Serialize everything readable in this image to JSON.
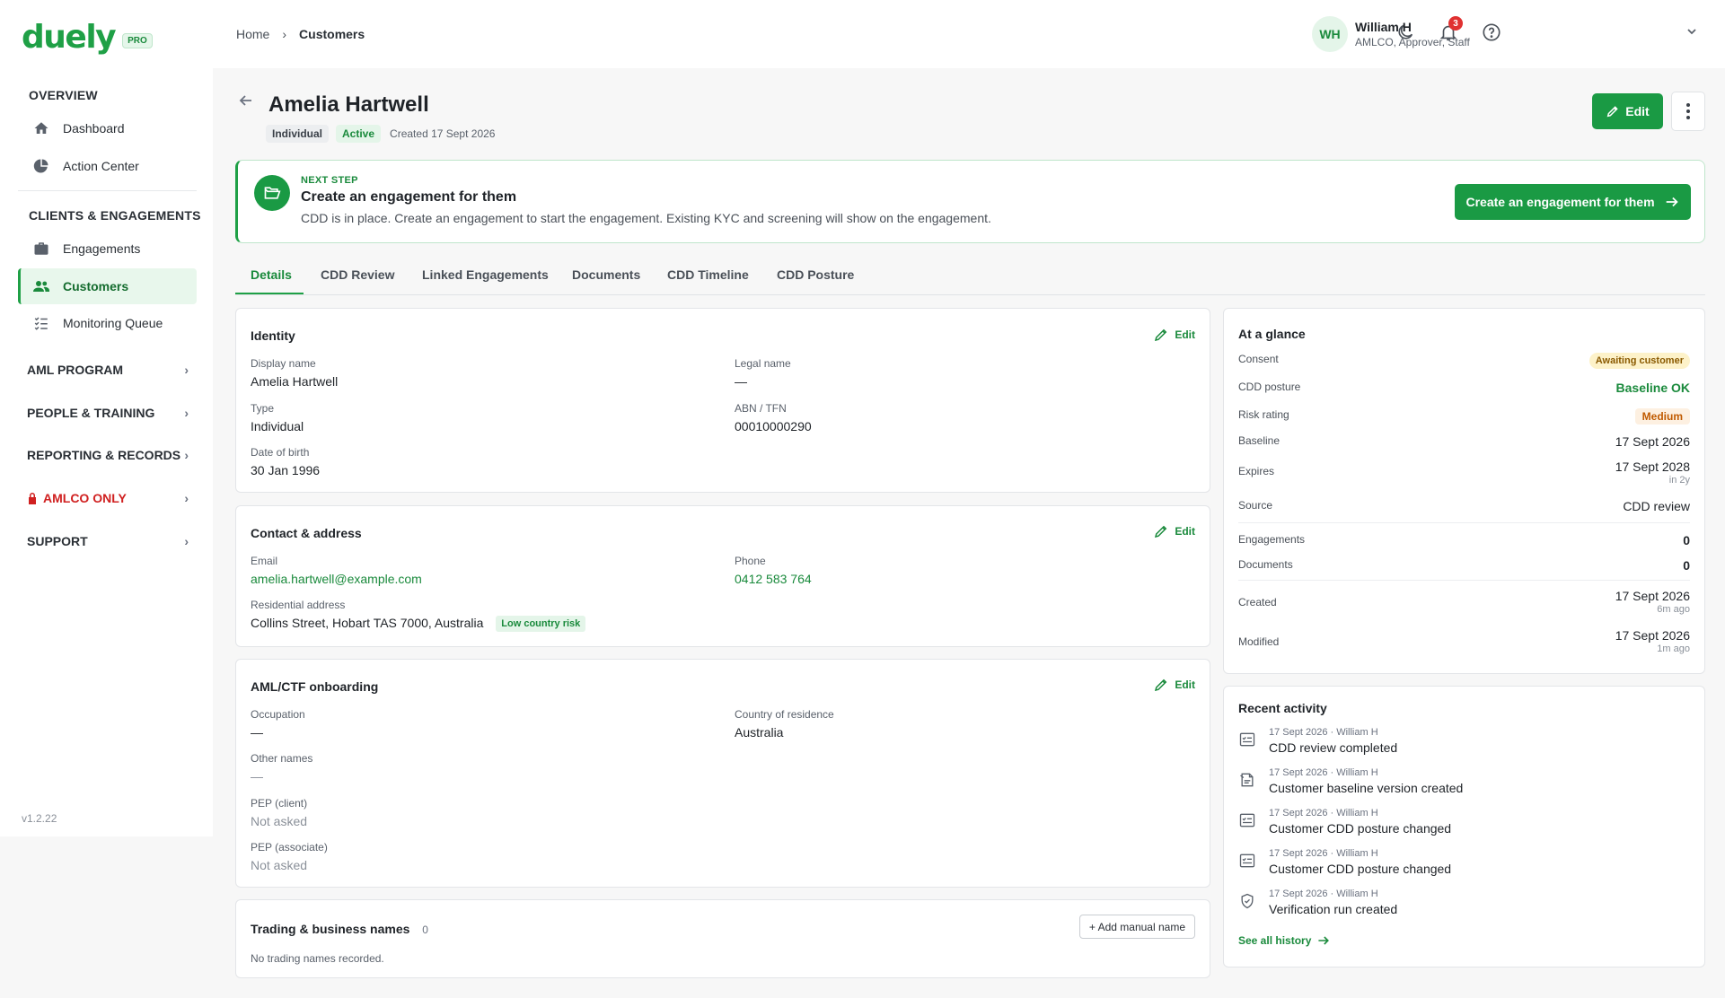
{
  "brand": {
    "name": "duely",
    "tier": "PRO"
  },
  "sidebar": {
    "overview_heading": "OVERVIEW",
    "overview_items": [
      {
        "label": "Dashboard",
        "icon": "home-icon"
      },
      {
        "label": "Action Center",
        "icon": "pie-chart-icon"
      }
    ],
    "clients_heading": "CLIENTS & ENGAGEMENTS",
    "clients_items": [
      {
        "label": "Engagements",
        "icon": "briefcase-icon"
      },
      {
        "label": "Customers",
        "icon": "users-icon",
        "active": true
      },
      {
        "label": "Monitoring Queue",
        "icon": "list-check-icon"
      }
    ],
    "groups": [
      {
        "label": "AML PROGRAM"
      },
      {
        "label": "PEOPLE & TRAINING"
      },
      {
        "label": "REPORTING & RECORDS"
      },
      {
        "label": "AMLCO ONLY",
        "icon": "lock-icon",
        "color": "#d02020"
      },
      {
        "label": "SUPPORT"
      }
    ],
    "version": "v1.2.22"
  },
  "topbar": {
    "breadcrumb": [
      "Home",
      "Customers"
    ],
    "notifications_count": "3",
    "user": {
      "initials": "WH",
      "name": "William H",
      "role": "AMLCO, Approver, Staff"
    }
  },
  "header": {
    "title": "Amelia Hartwell",
    "type_tag": "Individual",
    "status_tag": "Active",
    "created": "Created 17 Sept 2026",
    "edit_label": "Edit"
  },
  "banner": {
    "kicker": "NEXT STEP",
    "title": "Create an engagement for them",
    "description": "CDD is in place. Create an engagement to start the engagement. Existing KYC and screening will show on the engagement.",
    "button_label": "Create an engagement for them"
  },
  "tabs": [
    "Details",
    "CDD Review",
    "Linked Engagements",
    "Documents",
    "CDD Timeline",
    "CDD Posture"
  ],
  "identity": {
    "title": "Identity",
    "edit_label": "Edit",
    "display_name_label": "Display name",
    "display_name": "Amelia Hartwell",
    "legal_name_label": "Legal name",
    "legal_name": "—",
    "type_label": "Type",
    "type": "Individual",
    "abn_label": "ABN / TFN",
    "abn": "00010000290",
    "dob_label": "Date of birth",
    "dob": "30 Jan 1996"
  },
  "contact": {
    "title": "Contact & address",
    "edit_label": "Edit",
    "email_label": "Email",
    "email": "amelia.hartwell@example.com",
    "phone_label": "Phone",
    "phone": "0412 583 764",
    "address_label": "Residential address",
    "address": "Collins Street, Hobart TAS 7000, Australia",
    "risk_chip": "Low country risk"
  },
  "onboarding": {
    "title": "AML/CTF onboarding",
    "edit_label": "Edit",
    "occupation_label": "Occupation",
    "occupation": "—",
    "country_label": "Country of residence",
    "country": "Australia",
    "other_names_label": "Other names",
    "other_names": "—",
    "pep_client_label": "PEP (client)",
    "pep_client": "Not asked",
    "pep_associate_label": "PEP (associate)",
    "pep_associate": "Not asked"
  },
  "trading": {
    "title": "Trading & business names",
    "count": "0",
    "add_label": "+ Add manual name",
    "empty": "No trading names recorded."
  },
  "glance": {
    "title": "At a glance",
    "consent_label": "Consent",
    "consent": "Awaiting customer",
    "posture_label": "CDD posture",
    "posture": "Baseline OK",
    "risk_label": "Risk rating",
    "risk": "Medium",
    "baseline_label": "Baseline",
    "baseline": "17 Sept 2026",
    "expires_label": "Expires",
    "expires": "17 Sept 2028",
    "expires_sub": "in 2y",
    "source_label": "Source",
    "source": "CDD review",
    "engagements_label": "Engagements",
    "engagements": "0",
    "documents_label": "Documents",
    "documents": "0",
    "created_label": "Created",
    "created": "17 Sept 2026",
    "created_sub": "6m ago",
    "modified_label": "Modified",
    "modified": "17 Sept 2026",
    "modified_sub": "1m ago"
  },
  "activity": {
    "title": "Recent activity",
    "items": [
      {
        "meta": "17 Sept 2026 · William H",
        "text": "CDD review completed",
        "icon": "checklist-icon"
      },
      {
        "meta": "17 Sept 2026 · William H",
        "text": "Customer baseline version created",
        "icon": "file-version-icon"
      },
      {
        "meta": "17 Sept 2026 · William H",
        "text": "Customer CDD posture changed",
        "icon": "checklist-icon"
      },
      {
        "meta": "17 Sept 2026 · William H",
        "text": "Customer CDD posture changed",
        "icon": "checklist-icon"
      },
      {
        "meta": "17 Sept 2026 · William H",
        "text": "Verification run created",
        "icon": "shield-check-icon"
      }
    ],
    "see_all": "See all history"
  }
}
